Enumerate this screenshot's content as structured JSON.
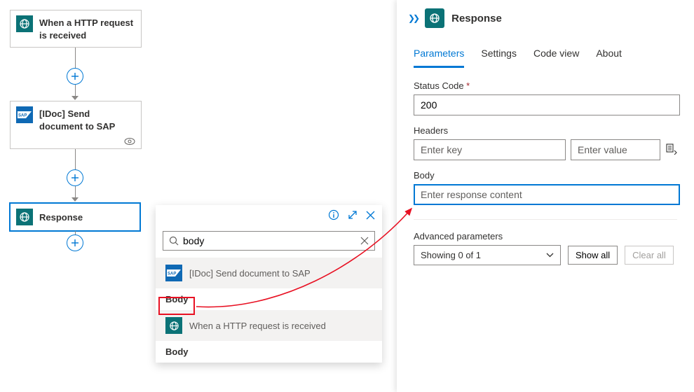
{
  "nodes": {
    "trigger": {
      "title": "When a HTTP request is received"
    },
    "sap": {
      "title": "[IDoc] Send document to SAP"
    },
    "response": {
      "title": "Response"
    }
  },
  "tokenPicker": {
    "searchValue": "body",
    "sources": {
      "sap": {
        "label": "[IDoc] Send document to SAP",
        "token": "Body"
      },
      "trigger": {
        "label": "When a HTTP request is received",
        "token": "Body"
      }
    }
  },
  "panel": {
    "title": "Response",
    "tabs": {
      "parameters": "Parameters",
      "settings": "Settings",
      "codeview": "Code view",
      "about": "About"
    },
    "statusCode": {
      "label": "Status Code",
      "value": "200"
    },
    "headers": {
      "label": "Headers",
      "keyPlaceholder": "Enter key",
      "valPlaceholder": "Enter value"
    },
    "body": {
      "label": "Body",
      "placeholder": "Enter response content"
    },
    "advanced": {
      "label": "Advanced parameters",
      "select": "Showing 0 of 1",
      "showAll": "Show all",
      "clearAll": "Clear all"
    }
  }
}
